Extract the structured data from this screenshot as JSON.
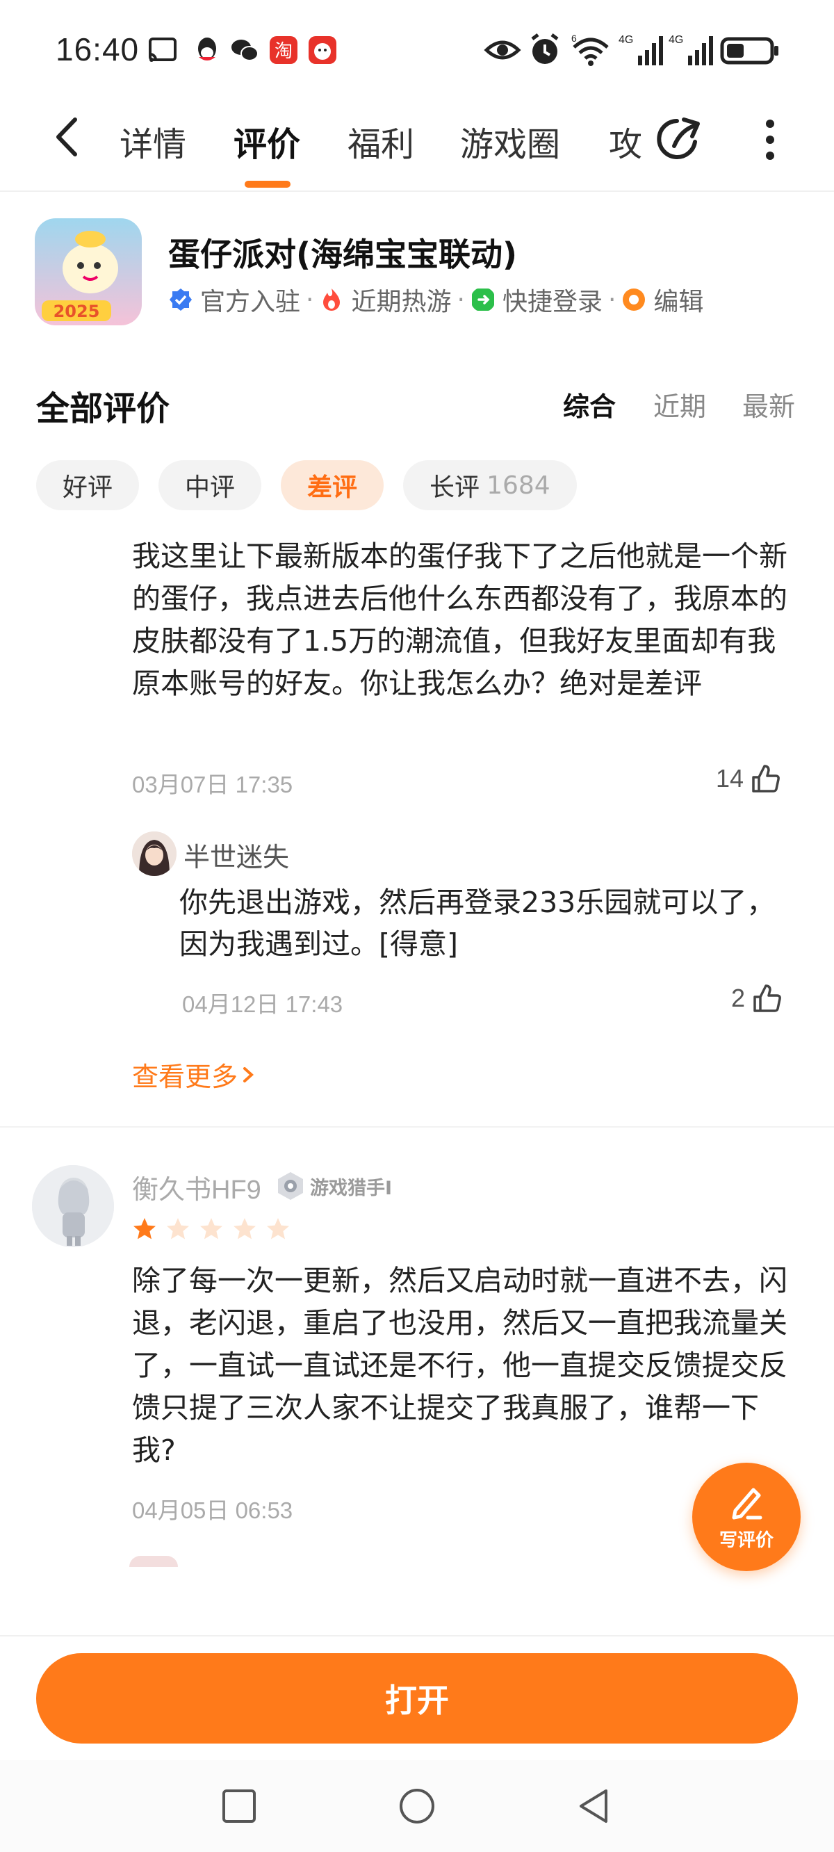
{
  "status_bar": {
    "time": "16:40",
    "app_icons": [
      "cast-icon",
      "qq-icon",
      "wechat-icon",
      "taobao-icon",
      "app-red-icon"
    ],
    "right_icons": [
      "eye-icon",
      "alarm-icon",
      "wifi-icon",
      "signal-4g-icon",
      "signal-4g-icon",
      "battery-icon"
    ],
    "net_label_1": "4G",
    "net_label_2": "4G",
    "wifi_label": "6"
  },
  "nav": {
    "tabs": [
      {
        "label": "详情",
        "active": false
      },
      {
        "label": "评价",
        "active": true
      },
      {
        "label": "福利",
        "active": false
      },
      {
        "label": "游戏圈",
        "active": false
      },
      {
        "label": "攻",
        "active": false
      }
    ],
    "accent": "#ff7a1a"
  },
  "game": {
    "title": "蛋仔派对(海绵宝宝联动)",
    "tags": [
      {
        "label": "官方入驻",
        "icon": "verified-icon",
        "color": "#3a7bf2"
      },
      {
        "label": "近期热游",
        "icon": "fire-icon",
        "color": "#ff4d3d"
      },
      {
        "label": "快捷登录",
        "icon": "login-icon",
        "color": "#2cbf4a"
      },
      {
        "label": "编辑",
        "icon": "editor-icon",
        "color": "#ff8a1f"
      }
    ],
    "tag_separator": "·"
  },
  "reviews": {
    "section_title": "全部评价",
    "sort_options": [
      {
        "label": "综合",
        "active": true
      },
      {
        "label": "近期",
        "active": false
      },
      {
        "label": "最新",
        "active": false
      }
    ],
    "filters": [
      {
        "label": "好评",
        "count": "",
        "active": false
      },
      {
        "label": "中评",
        "count": "",
        "active": false
      },
      {
        "label": "差评",
        "count": "",
        "active": true
      },
      {
        "label": "长评",
        "count": "1684",
        "active": false
      }
    ],
    "items": [
      {
        "text": "我这里让下最新版本的蛋仔我下了之后他就是一个新的蛋仔，我点进去后他什么东西都没有了，我原本的皮肤都没有了1.5万的潮流值，但我好友里面却有我原本账号的好友。你让我怎么办？绝对是差评",
        "date": "03月07日 17:35",
        "likes": "14",
        "reply": {
          "user": "半世迷失",
          "text": "你先退出游戏，然后再登录233乐园就可以了，因为我遇到过。[得意]",
          "date": "04月12日 17:43",
          "likes": "2"
        },
        "more_label": "查看更多"
      },
      {
        "user": "衡久书HF9",
        "badge": "游戏猎手I",
        "rating": 1,
        "max_rating": 5,
        "text": "除了每一次一更新，然后又启动时就一直进不去，闪退，老闪退，重启了也没用，然后又一直把我流量关了，一直试一直试还是不行，他一直提交反馈提交反馈只提了三次人家不让提交了我真服了，谁帮一下我?",
        "date": "04月05日 06:53"
      }
    ]
  },
  "fab": {
    "label": "写评价"
  },
  "bottom": {
    "open_label": "打开"
  },
  "system_nav": [
    "square-icon",
    "circle-icon",
    "triangle-back-icon"
  ]
}
